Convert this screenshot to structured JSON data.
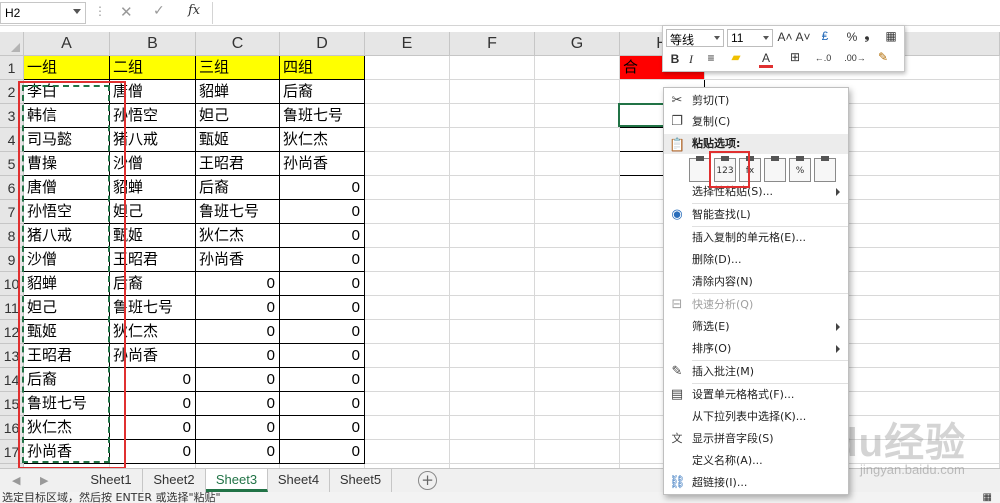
{
  "formula_bar": {
    "name_box": "H2",
    "dots": "⋮",
    "cancel": "✕",
    "enter": "✓",
    "fx": "fx",
    "formula": ""
  },
  "columns": [
    "A",
    "B",
    "C",
    "D",
    "E",
    "F",
    "G",
    "H",
    "K"
  ],
  "rows": [
    "1",
    "2",
    "3",
    "4",
    "5",
    "6",
    "7",
    "8",
    "9",
    "10",
    "11",
    "12",
    "13",
    "14",
    "15",
    "16",
    "17",
    "18"
  ],
  "cells": {
    "A": [
      "一组",
      "李白",
      "韩信",
      "司马懿",
      "曹操",
      "唐僧",
      "孙悟空",
      "猪八戒",
      "沙僧",
      "貂蝉",
      "妲己",
      "甄姬",
      "王昭君",
      "后裔",
      "鲁班七号",
      "狄仁杰",
      "孙尚香",
      ""
    ],
    "B": [
      "二组",
      "唐僧",
      "孙悟空",
      "猪八戒",
      "沙僧",
      "貂蝉",
      "妲己",
      "甄姬",
      "王昭君",
      "后裔",
      "鲁班七号",
      "狄仁杰",
      "孙尚香",
      "0",
      "0",
      "0",
      "0",
      ""
    ],
    "C": [
      "三组",
      "貂蝉",
      "妲己",
      "甄姬",
      "王昭君",
      "后裔",
      "鲁班七号",
      "狄仁杰",
      "孙尚香",
      "0",
      "0",
      "0",
      "0",
      "0",
      "0",
      "0",
      "0",
      ""
    ],
    "D": [
      "四组",
      "后裔",
      "鲁班七号",
      "狄仁杰",
      "孙尚香",
      "0",
      "0",
      "0",
      "0",
      "0",
      "0",
      "0",
      "0",
      "0",
      "0",
      "0",
      "0",
      ""
    ],
    "H1": "合"
  },
  "sheet_tabs": [
    {
      "label": "Sheet1",
      "active": false
    },
    {
      "label": "Sheet2",
      "active": false
    },
    {
      "label": "Sheet3",
      "active": true
    },
    {
      "label": "Sheet4",
      "active": false
    },
    {
      "label": "Sheet5",
      "active": false
    }
  ],
  "tab_nav": {
    "prev": "◀",
    "next": "▶",
    "add": "+"
  },
  "status_bar": {
    "text": "选定目标区域，然后按 ENTER 或选择\"粘贴\"",
    "view_icon": "▦"
  },
  "mini_toolbar": {
    "font_name": "等线",
    "font_size": "11",
    "grow_font": "A˄",
    "shrink_font": "A˅",
    "currency": "₤",
    "percent": "%",
    "comma": "❟",
    "format_icon": "▦",
    "bold": "B",
    "italic": "I",
    "align": "≡",
    "fill_color": "▰",
    "font_color": "A",
    "borders": "⊞",
    "dec_increase": "←.0",
    "dec_decrease": ".00→",
    "format_painter": "✎"
  },
  "context_menu": {
    "cut": "剪切(T)",
    "copy": "复制(C)",
    "paste_options": "粘贴选项:",
    "paste_special": "选择性粘贴(S)...",
    "smart_lookup": "智能查找(L)",
    "insert_copied": "插入复制的单元格(E)...",
    "delete": "删除(D)...",
    "clear": "清除内容(N)",
    "quick_analysis": "快速分析(Q)",
    "filter": "筛选(E)",
    "sort": "排序(O)",
    "insert_comment": "插入批注(M)",
    "format_cells": "设置单元格格式(F)...",
    "pick_list": "从下拉列表中选择(K)...",
    "phonetic": "显示拼音字段(S)",
    "define_name": "定义名称(A)...",
    "hyperlink": "超链接(I)...",
    "paste_icons": [
      "",
      "123",
      "fx",
      "",
      "%",
      ""
    ]
  },
  "watermark": {
    "text": "Baidu经验",
    "sub": "jingyan.baidu.com"
  },
  "colors": {
    "header_yellow": "#ffff00",
    "accent_green": "#217346",
    "highlight_red": "#e03030",
    "h1_red": "#ff0000"
  }
}
